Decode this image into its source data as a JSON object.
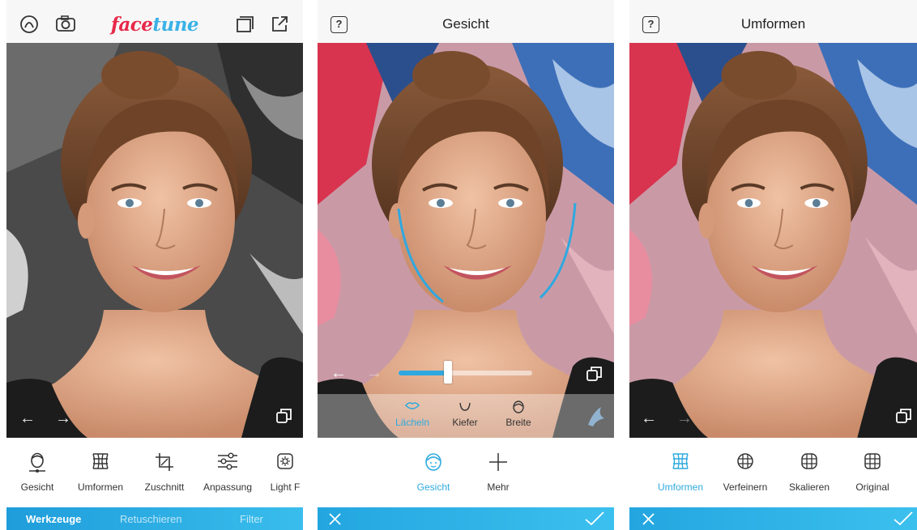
{
  "panel1": {
    "logo_face": "face",
    "logo_tune": "tune",
    "tools": [
      {
        "label": "Gesicht",
        "icon": "face-icon"
      },
      {
        "label": "Umformen",
        "icon": "reshape-grid-icon"
      },
      {
        "label": "Zuschnitt",
        "icon": "crop-icon"
      },
      {
        "label": "Anpassung",
        "icon": "sliders-icon"
      },
      {
        "label": "Light F",
        "icon": "light-icon"
      }
    ],
    "tabs": [
      "Werkzeuge",
      "Retuschieren",
      "Filter"
    ],
    "active_tab": "Werkzeuge"
  },
  "panel2": {
    "help": "?",
    "title": "Gesicht",
    "slider_value": 0.37,
    "subtools": [
      "Lächeln",
      "Kiefer",
      "Breite"
    ],
    "active_subtool": "Lächeln",
    "tools": [
      {
        "label": "Gesicht",
        "icon": "face-icon"
      },
      {
        "label": "Mehr",
        "icon": "plus-icon"
      }
    ]
  },
  "panel3": {
    "help": "?",
    "title": "Umformen",
    "tools": [
      {
        "label": "Umformen",
        "icon": "reshape-grid-icon"
      },
      {
        "label": "Verfeinern",
        "icon": "refine-grid-icon"
      },
      {
        "label": "Skalieren",
        "icon": "scale-grid-icon"
      },
      {
        "label": "Original",
        "icon": "original-grid-icon"
      }
    ]
  },
  "colors": {
    "accent": "#2eaadf",
    "logo_red": "#e8284a",
    "logo_blue": "#3ab2e6"
  }
}
